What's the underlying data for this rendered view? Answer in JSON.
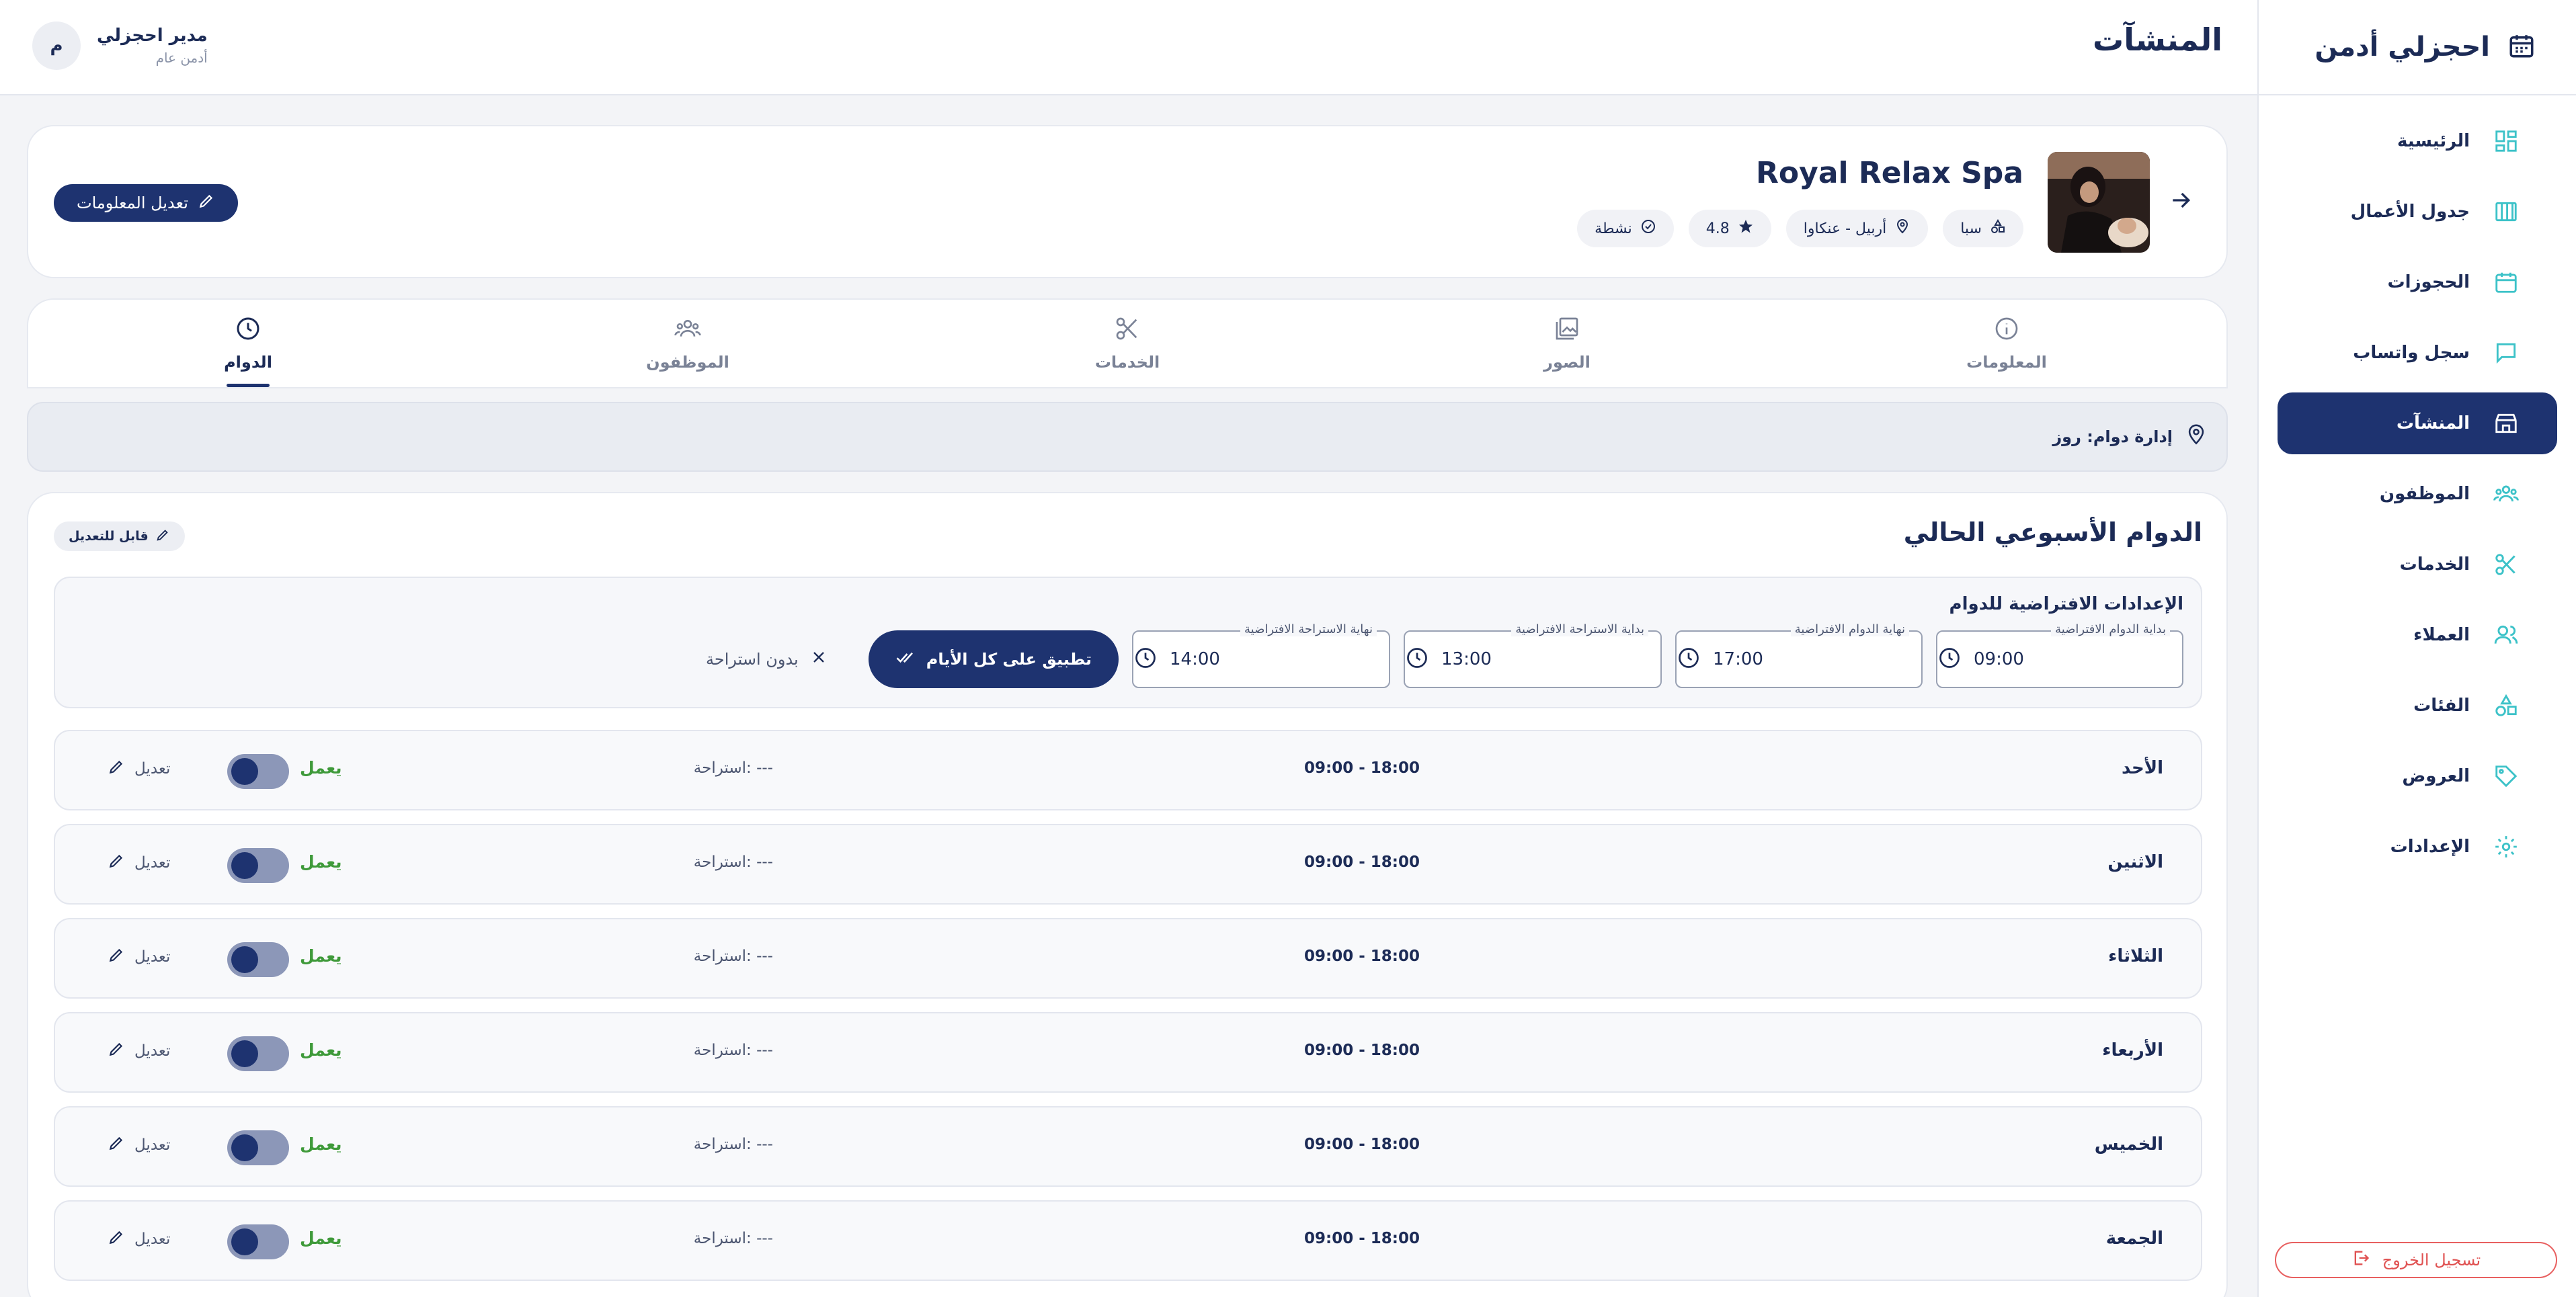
{
  "brand": {
    "title": "احجزلي أدمن"
  },
  "sidebar": {
    "items": [
      {
        "label": "الرئيسية",
        "icon": "dashboard-icon",
        "active": false
      },
      {
        "label": "جدول الأعمال",
        "icon": "calendar-columns-icon",
        "active": false
      },
      {
        "label": "الحجوزات",
        "icon": "calendar-icon",
        "active": false
      },
      {
        "label": "سجل واتساب",
        "icon": "chat-icon",
        "active": false
      },
      {
        "label": "المنشآت",
        "icon": "store-icon",
        "active": true
      },
      {
        "label": "الموظفون",
        "icon": "people-icon",
        "active": false
      },
      {
        "label": "الخدمات",
        "icon": "scissors-icon",
        "active": false
      },
      {
        "label": "العملاء",
        "icon": "customers-icon",
        "active": false
      },
      {
        "label": "الفئات",
        "icon": "categories-icon",
        "active": false
      },
      {
        "label": "العروض",
        "icon": "tag-icon",
        "active": false
      },
      {
        "label": "الإعدادات",
        "icon": "gear-icon",
        "active": false
      }
    ],
    "logout_label": "تسجيل الخروج"
  },
  "header": {
    "title": "المنشآت",
    "user": {
      "initial": "م",
      "name": "مدير احجزلي",
      "role": "أدمن عام"
    }
  },
  "facility": {
    "name": "Royal Relax Spa",
    "chips": {
      "category": "سبا",
      "location": "أربيل - عنكاوا",
      "rating": "4.8",
      "status": "نشطة"
    },
    "edit_label": "تعديل المعلومات"
  },
  "tabs": [
    {
      "label": "المعلومات",
      "icon": "info-icon",
      "active": false
    },
    {
      "label": "الصور",
      "icon": "gallery-icon",
      "active": false
    },
    {
      "label": "الخدمات",
      "icon": "scissors-icon",
      "active": false
    },
    {
      "label": "الموظفون",
      "icon": "people-icon",
      "active": false
    },
    {
      "label": "الدوام",
      "icon": "clock-icon",
      "active": true
    }
  ],
  "manage_bar": {
    "label": "إدارة دوام: روز"
  },
  "schedule": {
    "title": "الدوام الأسبوعي الحالي",
    "editable_badge": "قابل للتعديل",
    "defaults": {
      "title": "الإعدادات الافتراضية للدوام",
      "fields": [
        {
          "label": "بداية الدوام الافتراضية",
          "value": "09:00"
        },
        {
          "label": "نهاية الدوام الافتراضية",
          "value": "17:00"
        },
        {
          "label": "بداية الاستراحة الافتراضية",
          "value": "13:00"
        },
        {
          "label": "نهاية الاستراحة الافتراضية",
          "value": "14:00"
        }
      ],
      "apply_label": "تطبيق على كل الأيام",
      "no_break_label": "بدون استراحة"
    },
    "days": [
      {
        "name": "الأحد",
        "hours": "09:00 - 18:00",
        "break": "--- :استراحة",
        "status": "يعمل",
        "edit": "تعديل"
      },
      {
        "name": "الاثنين",
        "hours": "09:00 - 18:00",
        "break": "--- :استراحة",
        "status": "يعمل",
        "edit": "تعديل"
      },
      {
        "name": "الثلاثاء",
        "hours": "09:00 - 18:00",
        "break": "--- :استراحة",
        "status": "يعمل",
        "edit": "تعديل"
      },
      {
        "name": "الأربعاء",
        "hours": "09:00 - 18:00",
        "break": "--- :استراحة",
        "status": "يعمل",
        "edit": "تعديل"
      },
      {
        "name": "الخميس",
        "hours": "09:00 - 18:00",
        "break": "--- :استراحة",
        "status": "يعمل",
        "edit": "تعديل"
      },
      {
        "name": "الجمعة",
        "hours": "09:00 - 18:00",
        "break": "--- :استراحة",
        "status": "يعمل",
        "edit": "تعديل"
      }
    ]
  },
  "colors": {
    "primary": "#1e3370",
    "accent": "#3cc2c8",
    "success": "#3f9a3a",
    "danger": "#e05252"
  }
}
